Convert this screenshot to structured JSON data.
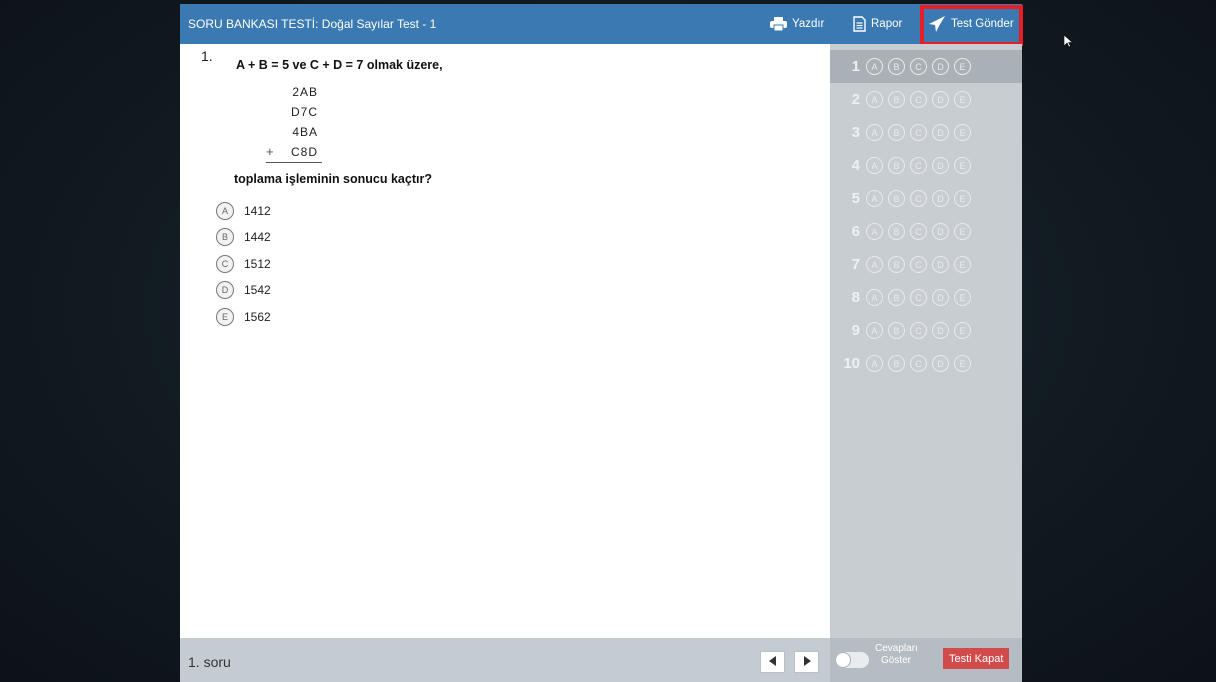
{
  "header": {
    "title": "SORU BANKASI TESTİ: Doğal Sayılar Test - 1",
    "print_label": "Yazdır",
    "report_label": "Rapor",
    "send_label": "Test Gönder"
  },
  "question": {
    "number": "1.",
    "statement": "A + B = 5  ve  C + D = 7  olmak üzere,",
    "addends": [
      "2AB",
      "D7C",
      "4BA",
      "C8D"
    ],
    "plus_sign": "+",
    "prompt": "toplama işleminin sonucu kaçtır?",
    "options": [
      {
        "letter": "A",
        "text": "1412"
      },
      {
        "letter": "B",
        "text": "1442"
      },
      {
        "letter": "C",
        "text": "1512"
      },
      {
        "letter": "D",
        "text": "1542"
      },
      {
        "letter": "E",
        "text": "1562"
      }
    ]
  },
  "answer_sheet": {
    "letters": [
      "A",
      "B",
      "C",
      "D",
      "E"
    ],
    "rows": [
      "1",
      "2",
      "3",
      "4",
      "5",
      "6",
      "7",
      "8",
      "9",
      "10"
    ],
    "active_row": "1"
  },
  "footer": {
    "current": "1. soru",
    "show_answers_line1": "Cevapları",
    "show_answers_line2": "Göster",
    "show_answers_on": false,
    "close_label": "Testi Kapat"
  },
  "colors": {
    "header_bg": "#3a79b2",
    "highlight": "#ea1c24",
    "close_button": "#d24b4b",
    "panel_bg": "#c8cdd2"
  }
}
